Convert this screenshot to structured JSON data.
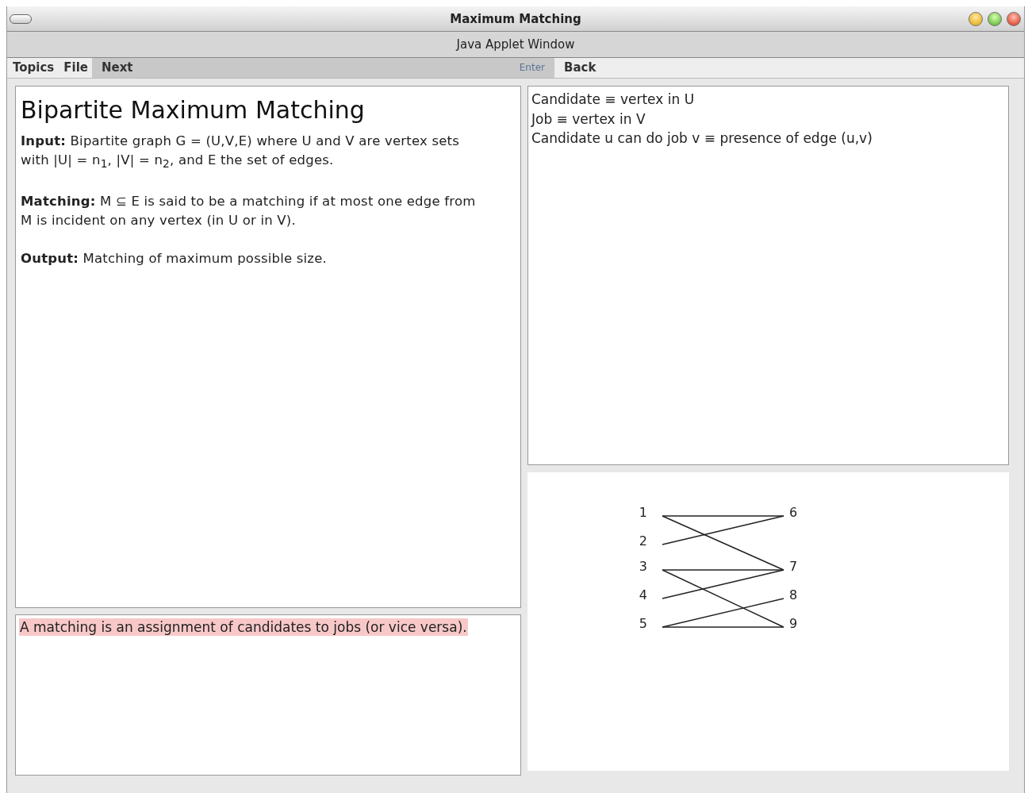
{
  "window": {
    "title": "Maximum Matching",
    "subtitle": "Java Applet Window"
  },
  "menu": [
    "Topics",
    "File"
  ],
  "navigation": [
    {
      "label": "Next",
      "disabled": false
    },
    {
      "label": "Enter",
      "disabled": true
    },
    {
      "label": "Back",
      "disabled": false
    }
  ],
  "description": {
    "heading": "Bipartite Maximum Matching",
    "paragraphs": [
      "**Input:** Bipartite graph G = (U,V,E) where U and V are vertex sets with |U| = n$_{1}$, |V| = n$_{2}$, and E the set of edges.",
      "**Matching:** M ⊆ E is said to be a matching if at most one edge from M is incident on any vertex (in U or in V).",
      "**Output:** Matching of maximum possible size."
    ]
  },
  "hint": {
    "text": "A matching is an assignment of candidates to jobs (or vice versa).",
    "highlighted": true
  },
  "definitions": [
    "Candidate ≡ vertex in U",
    "Job ≡ vertex in V",
    "Candidate u can do job v ≡ presence of edge (u,v)"
  ],
  "graph": {
    "u_vertices": [
      "1",
      "2",
      "3",
      "4",
      "5"
    ],
    "v_vertices": [
      "6",
      "7",
      "8",
      "9"
    ]
  }
}
